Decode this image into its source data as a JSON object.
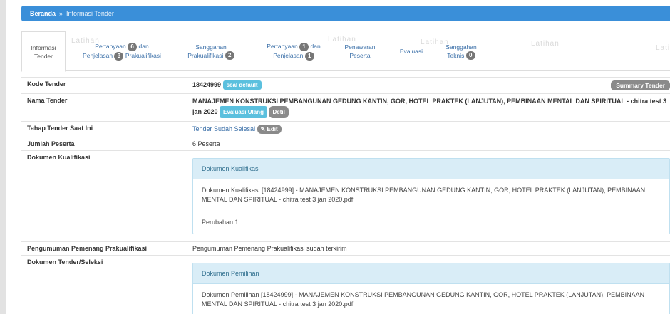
{
  "breadcrumb": {
    "home": "Beranda",
    "separator": "»",
    "current": "Informasi Tender"
  },
  "tabs": [
    {
      "line1": "Informasi",
      "line2": "Tender"
    },
    {
      "line1_pre": "Pertanyaan",
      "badge1": "6",
      "line1_post": "dan",
      "line2_pre": "Penjelasan",
      "badge2": "3",
      "line2_post": "Prakualifikasi"
    },
    {
      "line1": "Sanggahan",
      "line2_pre": "Prakualifikasi",
      "badge": "2"
    },
    {
      "line1_pre": "Pertanyaan",
      "badge1": "1",
      "line1_post": "dan",
      "line2_pre": "Penjelasan",
      "badge2": "1"
    },
    {
      "line1": "Penawaran",
      "line2": "Peserta"
    },
    {
      "line1": "Evaluasi"
    },
    {
      "line1": "Sanggahan",
      "line2_pre": "Teknis",
      "badge": "0"
    }
  ],
  "watermark": "Latihan",
  "rows": {
    "kode": {
      "label": "Kode Tender",
      "value": "18424999",
      "tag": "seal default",
      "summary": "Summary Tender"
    },
    "nama": {
      "label": "Nama Tender",
      "value": "MANAJEMEN KONSTRUKSI PEMBANGUNAN GEDUNG KANTIN, GOR, HOTEL PRAKTEK (LANJUTAN), PEMBINAAN MENTAL DAN SPIRITUAL - chitra test 3 jan 2020",
      "btn_eval": "Evaluasi Ulang",
      "btn_detil": "Detil"
    },
    "tahap": {
      "label": "Tahap Tender Saat Ini",
      "value": "Tender Sudah Selesai",
      "edit": "Edit"
    },
    "jumlah": {
      "label": "Jumlah Peserta",
      "value": "6 Peserta"
    },
    "dok_kual": {
      "label": "Dokumen Kualifikasi",
      "panel_title": "Dokumen Kualifikasi",
      "file": "Dokumen Kualifikasi [18424999] - MANAJEMEN KONSTRUKSI PEMBANGUNAN GEDUNG KANTIN, GOR, HOTEL PRAKTEK (LANJUTAN), PEMBINAAN MENTAL DAN SPIRITUAL - chitra test 3 jan 2020.pdf",
      "perubahan": "Perubahan 1"
    },
    "pengumuman": {
      "label": "Pengumuman Pemenang Prakualifikasi",
      "value": "Pengumuman Pemenang Prakualifikasi sudah terkirim"
    },
    "dok_tender": {
      "label": "Dokumen Tender/Seleksi",
      "panel_title": "Dokumen Pemilihan",
      "file": "Dokumen Pemilihan [18424999] - MANAJEMEN KONSTRUKSI PEMBANGUNAN GEDUNG KANTIN, GOR, HOTEL PRAKTEK (LANJUTAN), PEMBINAAN MENTAL DAN SPIRITUAL - chitra test 3 jan 2020.pdf"
    }
  }
}
